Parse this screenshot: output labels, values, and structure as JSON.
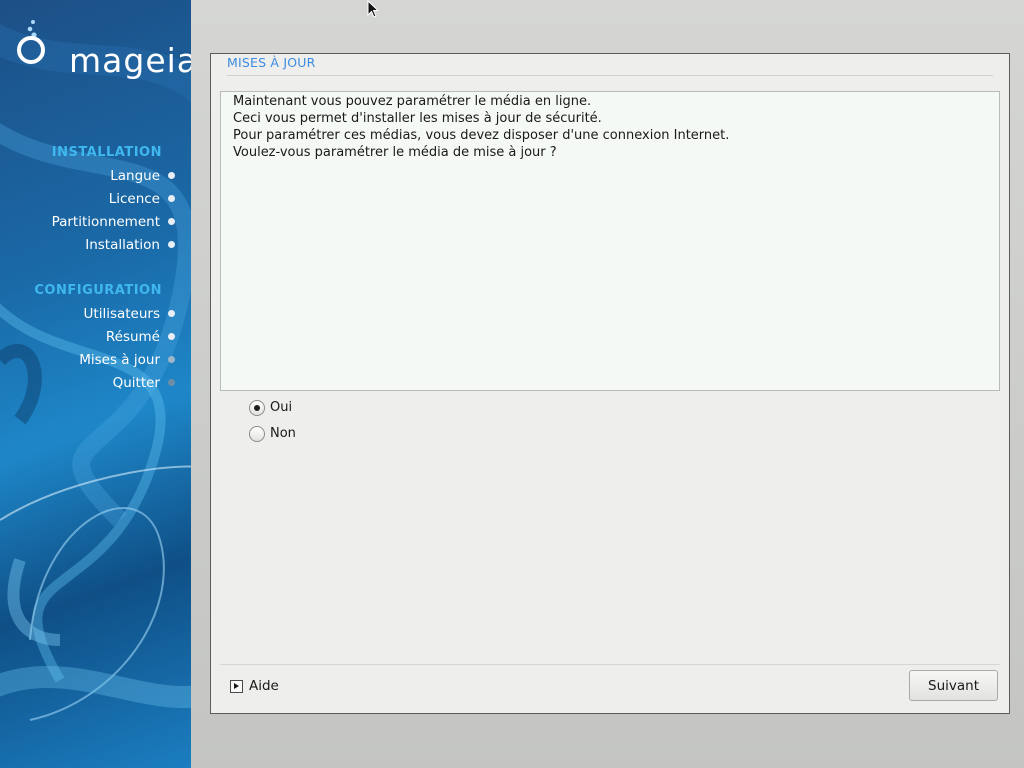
{
  "brand": {
    "name": "mageia"
  },
  "sidebar": {
    "sections": [
      {
        "title": "INSTALLATION",
        "items": [
          {
            "label": "Langue",
            "state": "done"
          },
          {
            "label": "Licence",
            "state": "done"
          },
          {
            "label": "Partitionnement",
            "state": "done"
          },
          {
            "label": "Installation",
            "state": "done"
          }
        ]
      },
      {
        "title": "CONFIGURATION",
        "items": [
          {
            "label": "Utilisateurs",
            "state": "done"
          },
          {
            "label": "Résumé",
            "state": "done"
          },
          {
            "label": "Mises à jour",
            "state": "current"
          },
          {
            "label": "Quitter",
            "state": "pending"
          }
        ]
      }
    ]
  },
  "dialog": {
    "title": "MISES À JOUR",
    "message_lines": [
      "Maintenant vous pouvez paramétrer le média en ligne.",
      "Ceci vous permet d'installer les mises à jour de sécurité.",
      "Pour paramétrer ces médias, vous devez disposer d'une connexion Internet.",
      "Voulez-vous paramétrer le média de mise à jour ?"
    ],
    "options": [
      {
        "label": "Oui",
        "selected": true
      },
      {
        "label": "Non",
        "selected": false
      }
    ],
    "help_label": "Aide",
    "next_label": "Suivant"
  },
  "colors": {
    "accent": "#3d8be0",
    "section_title": "#3fb7ef",
    "sidebar_bg": "#1a6aa8"
  }
}
